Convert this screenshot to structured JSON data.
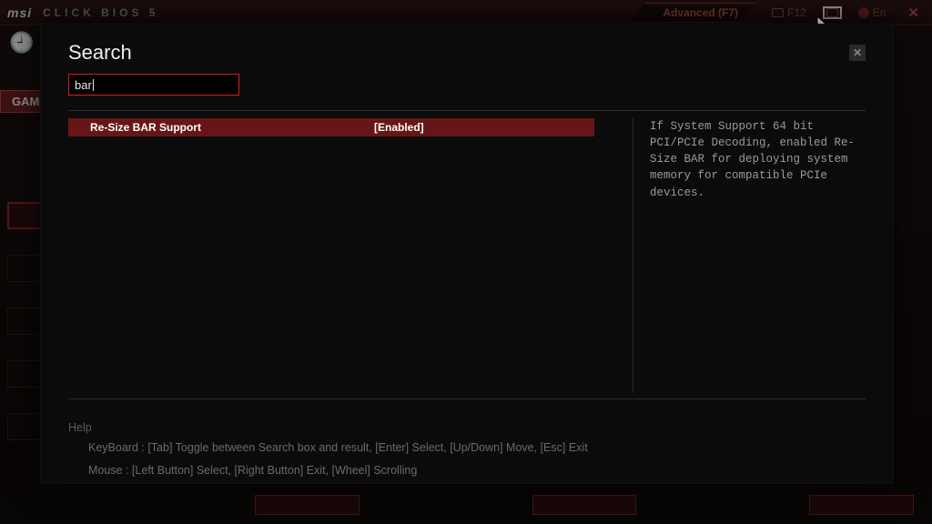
{
  "bios": {
    "brand": "msi",
    "product": "CLICK BIOS 5",
    "mode_tab": "Advanced (F7)",
    "hotkey_label": "F12",
    "language": "En",
    "side_tab": "GAMI"
  },
  "modal": {
    "title": "Search",
    "search_value": "bar",
    "result": {
      "name": "Re-Size BAR Support",
      "value": "[Enabled]"
    },
    "description": "If System Support 64 bit PCI/PCIe Decoding, enabled Re-Size BAR for deploying system memory for compatible PCIe devices."
  },
  "help": {
    "heading": "Help",
    "keyboard": "KeyBoard :  [Tab]  Toggle between Search box and result,   [Enter]  Select,   [Up/Down]  Move,   [Esc]  Exit",
    "mouse": "Mouse      :  [Left Button]  Select,   [Right Button]  Exit,   [Wheel]  Scrolling"
  }
}
